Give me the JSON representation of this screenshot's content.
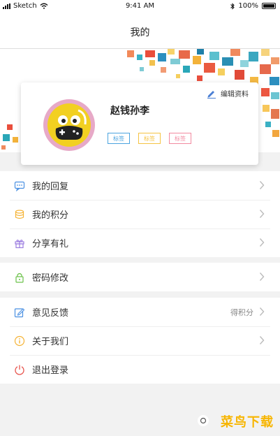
{
  "status_bar": {
    "carrier": "Sketch",
    "time": "9:41 AM",
    "battery": "100%"
  },
  "nav": {
    "title": "我的"
  },
  "profile": {
    "name": "赵钱孙李",
    "edit_label": "编辑资料",
    "tags": [
      {
        "label": "标签",
        "color": "#4aa3df"
      },
      {
        "label": "标签",
        "color": "#f5c342"
      },
      {
        "label": "标签",
        "color": "#f28aa0"
      }
    ]
  },
  "menu_groups": [
    {
      "items": [
        {
          "label": "我的回复",
          "icon": "message-icon",
          "icon_color": "#4a90e2"
        },
        {
          "label": "我的积分",
          "icon": "coins-icon",
          "icon_color": "#f5b335"
        },
        {
          "label": "分享有礼",
          "icon": "gift-icon",
          "icon_color": "#9b7de0"
        }
      ]
    },
    {
      "items": [
        {
          "label": "密码修改",
          "icon": "lock-icon",
          "icon_color": "#6cc24a"
        }
      ]
    },
    {
      "items": [
        {
          "label": "意见反馈",
          "icon": "feedback-icon",
          "icon_color": "#4a90e2",
          "note": "得积分"
        },
        {
          "label": "关于我们",
          "icon": "info-icon",
          "icon_color": "#f5b335"
        },
        {
          "label": "退出登录",
          "icon": "power-icon",
          "icon_color": "#e8554e"
        }
      ]
    }
  ],
  "watermark": "菜鸟下载"
}
